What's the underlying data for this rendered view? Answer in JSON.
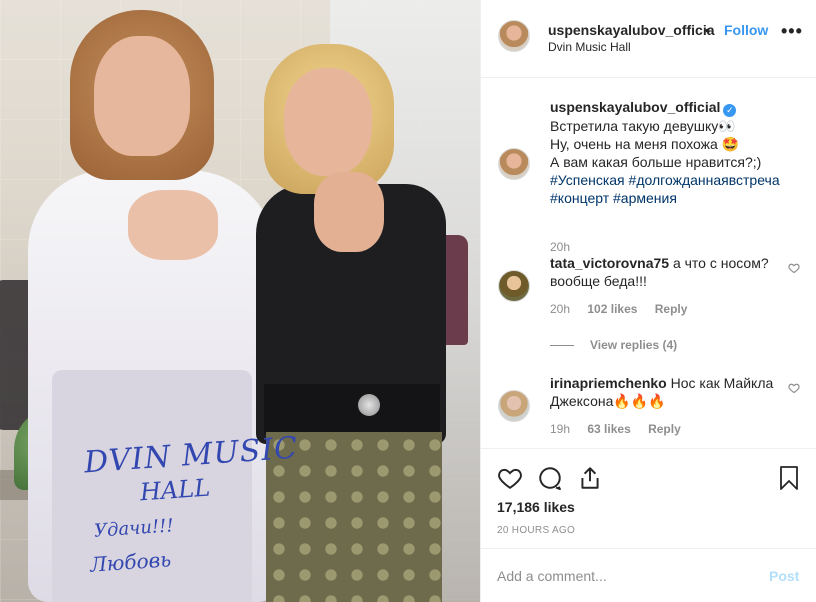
{
  "post": {
    "username": "uspenskayalubov_officia",
    "separator": "•",
    "follow_label": "Follow",
    "location": "Dvin Music Hall",
    "more_icon": "more-horizontal-icon",
    "more_label": "•••"
  },
  "photo": {
    "signature_lines": [
      "DVIN MUSIC",
      "HALL",
      "Удачи!!!",
      "Любовь"
    ]
  },
  "caption": {
    "username": "uspenskayalubov_official",
    "verified_icon": "verified-badge-icon",
    "verified_mark": "✓",
    "lines": [
      "Встретила такую девушку👀",
      "Ну, очень на меня похожа 🤩",
      "А вам какая больше нравится?;)"
    ],
    "hashtags_line1": [
      "#Успенская",
      "#долгожданнаявстреча"
    ],
    "hashtags_line2": [
      "#концерт",
      "#армения"
    ],
    "time": "20h"
  },
  "comments": [
    {
      "username": "tata_victorovna75",
      "text": "а что с носом? вообще беда!!!",
      "time": "20h",
      "likes": "102 likes",
      "reply": "Reply"
    },
    {
      "username": "irinapriemchenko",
      "text": "Нос как Майкла Джексона🔥🔥🔥",
      "time": "19h",
      "likes": "63 likes",
      "reply": "Reply"
    }
  ],
  "view_replies": "View replies (4)",
  "actions": {
    "icons": [
      "heart-icon",
      "comment-icon",
      "share-icon",
      "bookmark-icon"
    ],
    "likes": "17,186 likes",
    "time_ago": "20 HOURS AGO"
  },
  "add_comment": {
    "placeholder": "Add a comment...",
    "post_label": "Post"
  },
  "colors": {
    "link_blue": "#3897f0",
    "hashtag": "#003569",
    "muted": "#8e8e8e",
    "post_disabled": "#b2dffc",
    "signature_ink": "#3347b0"
  }
}
